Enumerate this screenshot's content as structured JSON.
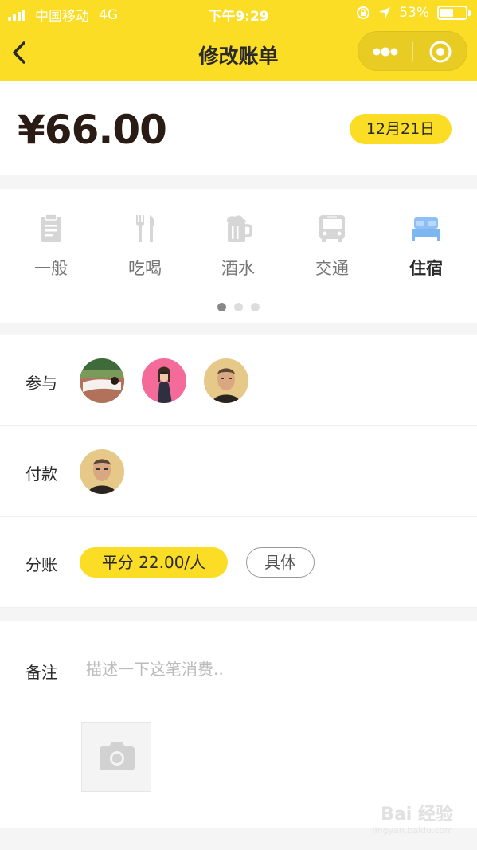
{
  "status_bar": {
    "carrier": "中国移动",
    "network": "4G",
    "time": "下午9:29",
    "battery_percent_text": "53%",
    "battery_level": 0.53
  },
  "nav": {
    "title": "修改账单",
    "back_icon": "chevron-left-icon",
    "more_icon": "more-dots-icon",
    "close_icon": "target-circle-icon"
  },
  "bill": {
    "amount": "¥66.00",
    "date": "12月21日"
  },
  "categories": [
    {
      "label": "一般",
      "icon": "clipboard-icon",
      "active": false
    },
    {
      "label": "吃喝",
      "icon": "fork-knife-icon",
      "active": false
    },
    {
      "label": "酒水",
      "icon": "beer-mug-icon",
      "active": false
    },
    {
      "label": "交通",
      "icon": "bus-icon",
      "active": false
    },
    {
      "label": "住宿",
      "icon": "bed-icon",
      "active": true
    }
  ],
  "pager": {
    "count": 3,
    "active_index": 0
  },
  "participants": {
    "label": "参与",
    "avatars": [
      "avatar-person-lying-on-grass",
      "avatar-woman-pink-background",
      "avatar-man-portrait"
    ]
  },
  "payment": {
    "label": "付款",
    "avatars": [
      "avatar-man-portrait"
    ]
  },
  "split": {
    "label": "分账",
    "even_button": "平分 22.00/人",
    "detail_button": "具体"
  },
  "note": {
    "label": "备注",
    "placeholder": "描述一下这笔消费..",
    "photo_icon": "camera-icon"
  },
  "watermark": {
    "text": "Bai 经验",
    "sub": "jingyan.baidu.com"
  },
  "colors": {
    "accent_yellow": "#fcdd26",
    "active_icon_blue": "#7eb6f2",
    "inactive_icon_gray": "#d0d0d0"
  }
}
